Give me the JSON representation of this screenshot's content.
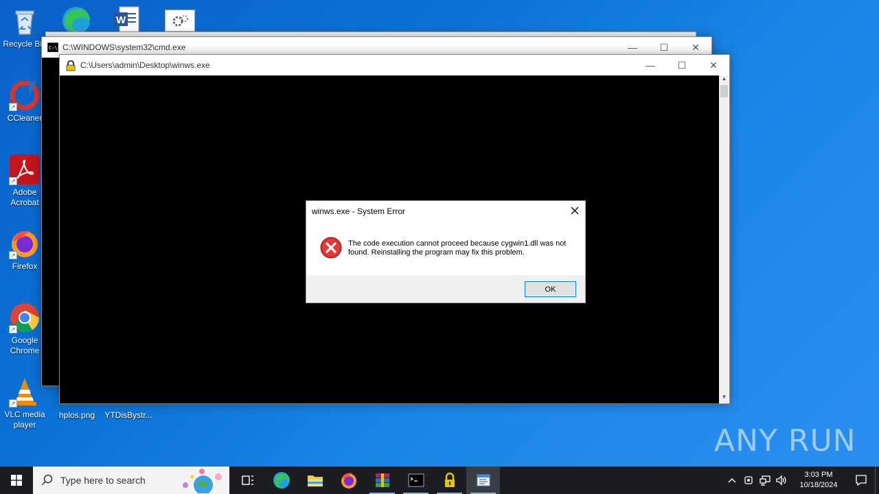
{
  "desktop": {
    "icons": [
      {
        "label": "Recycle Bin"
      },
      {
        "label": "CCleaner"
      },
      {
        "label": "Adobe Acrobat"
      },
      {
        "label": "Firefox"
      },
      {
        "label": "Google Chrome"
      },
      {
        "label": "VLC media player"
      },
      {
        "label": "hplos.png"
      },
      {
        "label": "YTDisBystr..."
      }
    ]
  },
  "windows": {
    "cmd": {
      "title": "C:\\WINDOWS\\system32\\cmd.exe"
    },
    "winws": {
      "title": "C:\\Users\\admin\\Desktop\\winws.exe"
    }
  },
  "dialog": {
    "title": "winws.exe - System Error",
    "message": "The code execution cannot proceed because cygwin1.dll was not found. Reinstalling the program may fix this problem.",
    "ok_label": "OK"
  },
  "taskbar": {
    "search_placeholder": "Type here to search",
    "time": "3:03 PM",
    "date": "10/18/2024",
    "apps": [
      "task-view",
      "edge",
      "file-explorer",
      "firefox",
      "winrar",
      "cmd",
      "winws-lock",
      "notepad"
    ]
  },
  "watermark": {
    "text": "ANY RUN"
  },
  "colors": {
    "accent": "#0078d7",
    "error": "#d32f2f",
    "taskbar": "#1b1d22"
  }
}
